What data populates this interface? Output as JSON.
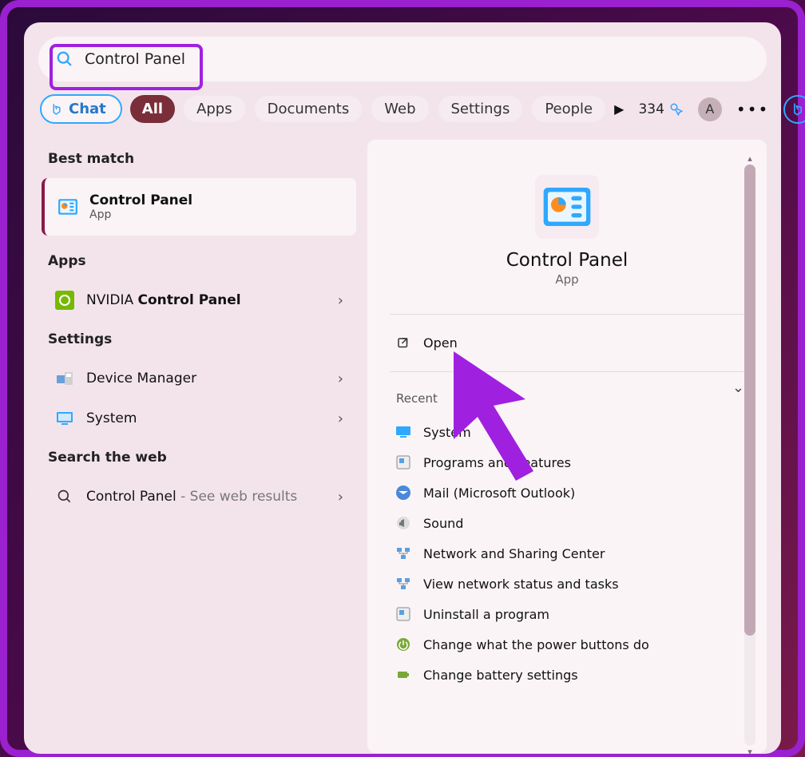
{
  "search": {
    "query": "Control Panel"
  },
  "filters": {
    "chat": "Chat",
    "all": "All",
    "items": [
      "Apps",
      "Documents",
      "Web",
      "Settings",
      "People"
    ]
  },
  "rewards": {
    "points": "334",
    "avatar_letter": "A"
  },
  "left": {
    "best_match_h": "Best match",
    "best": {
      "title": "Control Panel",
      "sub": "App"
    },
    "apps_h": "Apps",
    "apps": [
      {
        "prefix": "NVIDIA ",
        "bold": "Control Panel"
      }
    ],
    "settings_h": "Settings",
    "settings": [
      {
        "label": "Device Manager"
      },
      {
        "label": "System"
      }
    ],
    "web_h": "Search the web",
    "web": {
      "label": "Control Panel",
      "suffix": " - See web results"
    }
  },
  "right": {
    "title": "Control Panel",
    "sub": "App",
    "open": "Open",
    "recent_h": "Recent",
    "recent": [
      "System",
      "Programs and Features",
      "Mail (Microsoft Outlook)",
      "Sound",
      "Network and Sharing Center",
      "View network status and tasks",
      "Uninstall a program",
      "Change what the power buttons do",
      "Change battery settings"
    ]
  }
}
